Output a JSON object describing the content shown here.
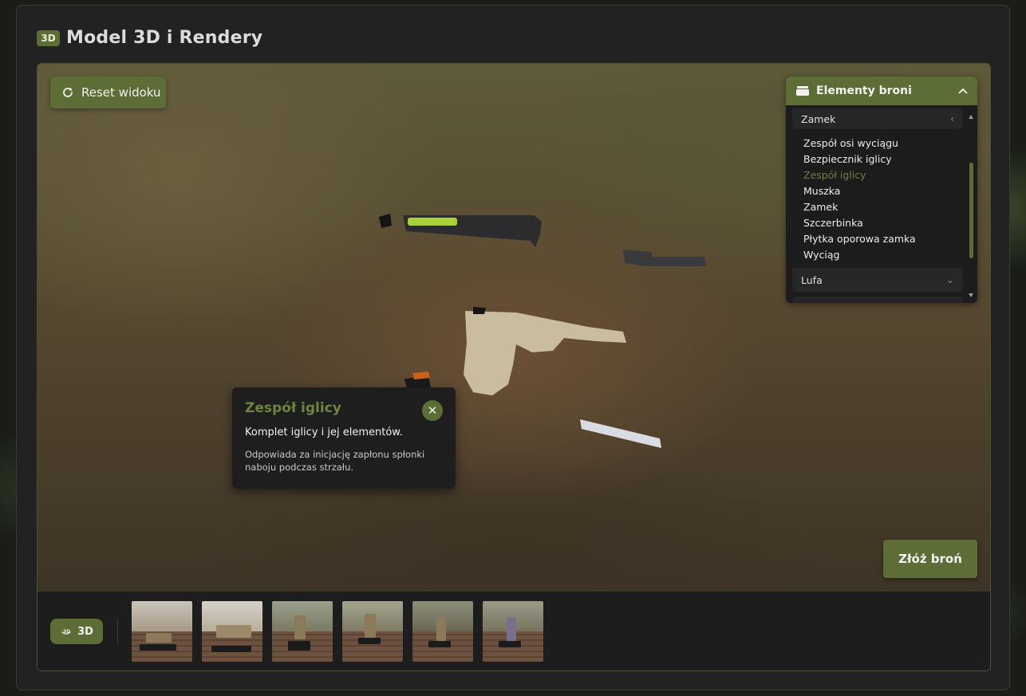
{
  "header": {
    "badge": "3D",
    "title": "Model 3D i Rendery"
  },
  "viewer": {
    "reset_label": "Reset widoku",
    "assemble_label": "Złóż broń"
  },
  "parts_panel": {
    "title": "Elementy broni",
    "groups": [
      {
        "label": "Zamek",
        "expanded": true,
        "items": [
          "Zespół osi wyciągu",
          "Bezpiecznik iglicy",
          "Zespół iglicy",
          "Muszka",
          "Zamek",
          "Szczerbinka",
          "Płytka oporowa zamka",
          "Wyciąg"
        ],
        "active_item": "Zespół iglicy"
      },
      {
        "label": "Lufa",
        "expanded": false
      }
    ]
  },
  "info_popup": {
    "title": "Zespół iglicy",
    "subtitle": "Komplet iglicy i jej elementów.",
    "description": "Odpowiada za inicjację zapłonu spłonki naboju podczas strzału."
  },
  "thumbnails": {
    "mode_label": "3D",
    "count": 6
  },
  "colors": {
    "accent": "#5c6e35",
    "active_text": "#6c7f40",
    "panel_bg": "#1c1c1c"
  }
}
